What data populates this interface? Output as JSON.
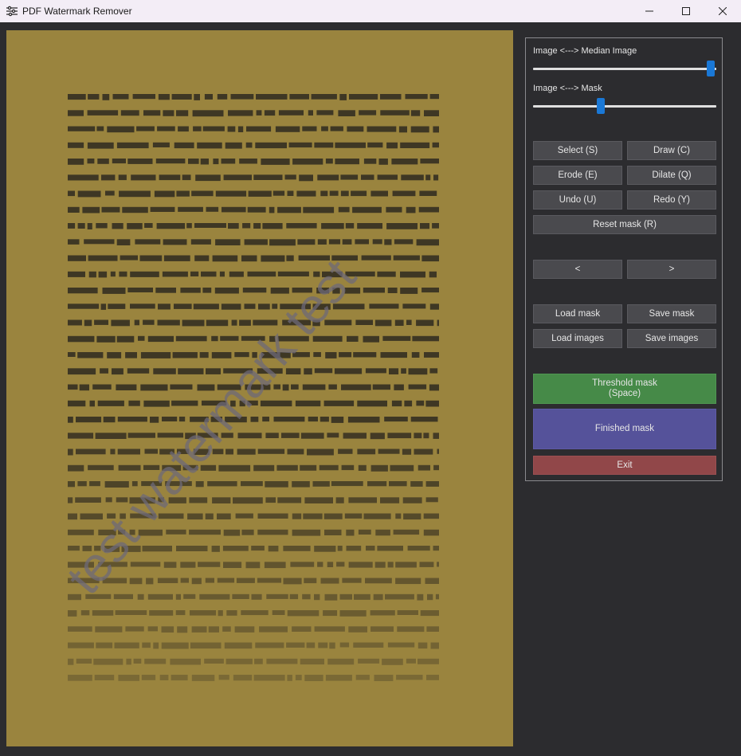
{
  "window": {
    "title": "PDF Watermark Remover",
    "icon": "sliders-icon"
  },
  "canvas": {
    "watermark_text": "test watermark test",
    "background_color": "#9a843e",
    "text_color": "#2f2a20"
  },
  "sliders": [
    {
      "label": "Image <---> Median Image",
      "value": 0.97
    },
    {
      "label": "Image <---> Mask",
      "value": 0.37
    }
  ],
  "buttons": {
    "select": "Select (S)",
    "draw": "Draw (C)",
    "erode": "Erode (E)",
    "dilate": "Dilate (Q)",
    "undo": "Undo (U)",
    "redo": "Redo (Y)",
    "reset_mask": "Reset mask (R)",
    "prev": "<",
    "next": ">",
    "load_mask": "Load mask",
    "save_mask": "Save mask",
    "load_images": "Load images",
    "save_images": "Save images",
    "threshold_line1": "Threshold mask",
    "threshold_line2": "(Space)",
    "finished_mask": "Finished mask",
    "exit": "Exit"
  },
  "colors": {
    "threshold": "#468a48",
    "finished": "#55529a",
    "exit": "#914749",
    "slider_thumb": "#1a78d6"
  }
}
